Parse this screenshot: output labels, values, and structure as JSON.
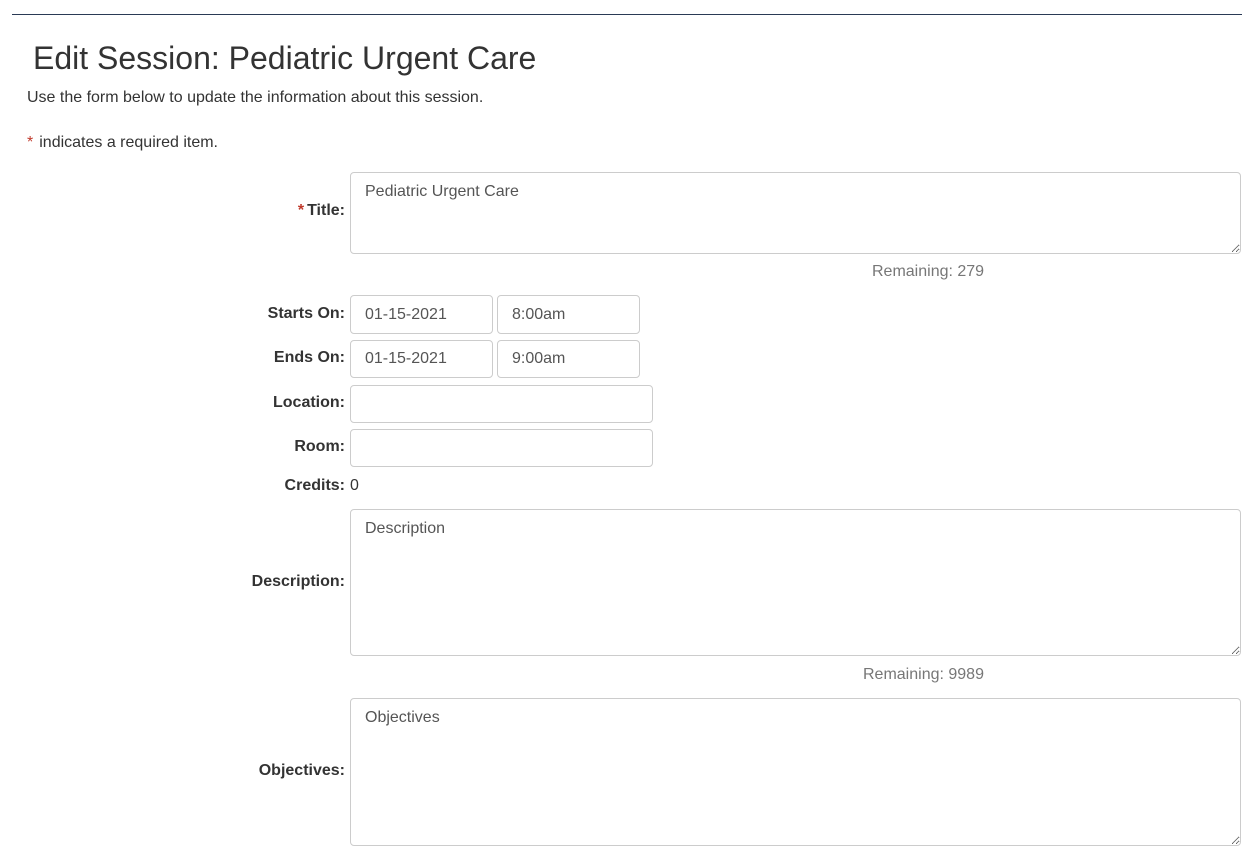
{
  "page": {
    "title": "Edit Session: Pediatric Urgent Care",
    "intro": "Use the form below to update the information about this session.",
    "required_star": "*",
    "required_note": "indicates a required item."
  },
  "form": {
    "title": {
      "label": "Title:",
      "required": true,
      "value": "Pediatric Urgent Care",
      "remaining": "Remaining: 279"
    },
    "starts_on": {
      "label": "Starts On:",
      "date": "01-15-2021",
      "time": "8:00am"
    },
    "ends_on": {
      "label": "Ends On:",
      "date": "01-15-2021",
      "time": "9:00am"
    },
    "location": {
      "label": "Location:",
      "value": ""
    },
    "room": {
      "label": "Room:",
      "value": ""
    },
    "credits": {
      "label": "Credits:",
      "value": "0"
    },
    "description": {
      "label": "Description:",
      "placeholder": "Description",
      "value": "",
      "remaining": "Remaining: 9989"
    },
    "objectives": {
      "label": "Objectives:",
      "placeholder": "Objectives",
      "value": ""
    }
  },
  "colors": {
    "accent_rule": "#2a3a55",
    "required_star": "#c0392b",
    "border": "#cccccc"
  }
}
